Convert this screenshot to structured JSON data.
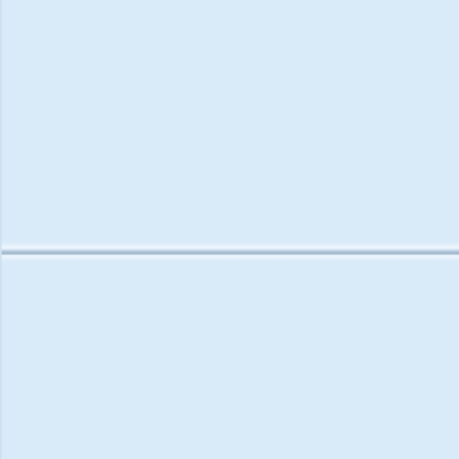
{
  "window": {
    "background": "#d9eaf9"
  },
  "splitter": {
    "orientation": "horizontal",
    "line_color": "#a8bdd1"
  },
  "panes": [
    {
      "name": "top"
    },
    {
      "name": "bottom"
    }
  ]
}
